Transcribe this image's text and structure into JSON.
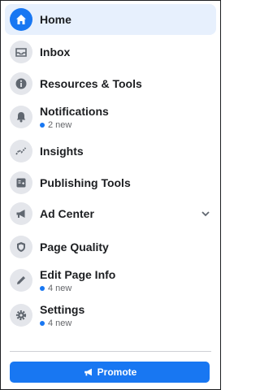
{
  "nav": {
    "items": [
      {
        "label": "Home",
        "icon": "home-icon",
        "active": true
      },
      {
        "label": "Inbox",
        "icon": "inbox-icon"
      },
      {
        "label": "Resources & Tools",
        "icon": "info-icon"
      },
      {
        "label": "Notifications",
        "icon": "bell-icon",
        "sub": "2 new"
      },
      {
        "label": "Insights",
        "icon": "insights-icon"
      },
      {
        "label": "Publishing Tools",
        "icon": "publishing-tools-icon"
      },
      {
        "label": "Ad Center",
        "icon": "megaphone-icon",
        "has_chevron": true
      },
      {
        "label": "Page Quality",
        "icon": "shield-icon"
      },
      {
        "label": "Edit Page Info",
        "icon": "pencil-icon",
        "sub": "4 new"
      },
      {
        "label": "Settings",
        "icon": "gear-icon",
        "sub": "4 new"
      }
    ]
  },
  "promote": {
    "label": "Promote",
    "icon": "megaphone-icon"
  },
  "colors": {
    "accent": "#1877f2",
    "active_bg": "#e7f0fd",
    "icon_bg": "#e4e6eb",
    "text": "#1c1e21",
    "subtext": "#65676b"
  }
}
